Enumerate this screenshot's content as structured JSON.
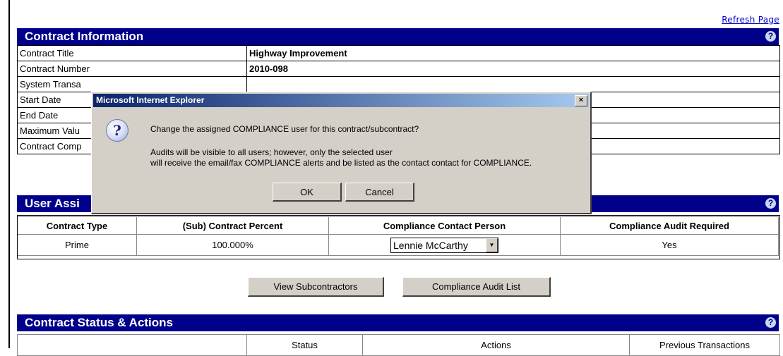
{
  "refresh_link": "Refresh Page",
  "help_glyph": "?",
  "contract_info": {
    "title": "Contract Information",
    "rows": [
      {
        "label": "Contract Title",
        "value": "Highway Improvement"
      },
      {
        "label": "Contract Number",
        "value": "2010-098"
      },
      {
        "label": "System Transa",
        "value": ""
      },
      {
        "label": "Start Date",
        "value": ""
      },
      {
        "label": "End Date",
        "value": ""
      },
      {
        "label": "Maximum Valu",
        "value": ""
      },
      {
        "label": "Contract Comp",
        "value": ""
      }
    ]
  },
  "user_assign": {
    "title": "User Assi",
    "headers": [
      "Contract Type",
      "(Sub) Contract Percent",
      "Compliance Contact Person",
      "Compliance Audit Required"
    ],
    "row": {
      "type": "Prime",
      "percent": "100.000%",
      "contact": "Lennie McCarthy",
      "audit": "Yes"
    }
  },
  "buttons": {
    "view_subs": "View Subcontractors",
    "audit_list": "Compliance Audit List"
  },
  "status_actions": {
    "title": "Contract Status & Actions",
    "headers": [
      "",
      "Status",
      "Actions",
      "Previous Transactions"
    ]
  },
  "dialog": {
    "title": "Microsoft Internet Explorer",
    "close_glyph": "×",
    "icon_glyph": "?",
    "question": "Change the assigned COMPLIANCE user for this contract/subcontract?",
    "detail_line1": "Audits will be visible to all users; however, only the selected user",
    "detail_line2": "will receive the email/fax COMPLIANCE alerts and be listed as the contact contact for COMPLIANCE.",
    "ok_label": "OK",
    "cancel_label": "Cancel"
  },
  "colors": {
    "section_bar": "#00008b",
    "dialog_face": "#d4d0c8",
    "link": "#0000cc"
  }
}
